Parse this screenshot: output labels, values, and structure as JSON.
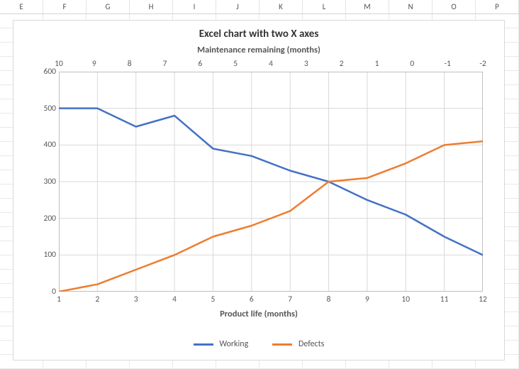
{
  "columns": [
    "E",
    "F",
    "G",
    "H",
    "I",
    "J",
    "K",
    "L",
    "M",
    "N",
    "O",
    "P"
  ],
  "chart_data": {
    "type": "line",
    "title": "Excel chart with two X axes",
    "xlabel": "Product life (months)",
    "secondary_xlabel": "Maintenance remaining (months)",
    "ylabel": "",
    "ylim": [
      0,
      600
    ],
    "y_ticks": [
      0,
      100,
      200,
      300,
      400,
      500,
      600
    ],
    "x": [
      1,
      2,
      3,
      4,
      5,
      6,
      7,
      8,
      9,
      10,
      11,
      12
    ],
    "secondary_x": [
      10,
      9,
      8,
      7,
      6,
      5,
      4,
      3,
      2,
      1,
      0,
      -1,
      -2
    ],
    "series": [
      {
        "name": "Working",
        "color": "#4472C4",
        "values": [
          500,
          500,
          450,
          480,
          390,
          370,
          330,
          300,
          250,
          210,
          150,
          100
        ]
      },
      {
        "name": "Defects",
        "color": "#ED7D31",
        "values": [
          0,
          20,
          60,
          100,
          150,
          180,
          220,
          300,
          310,
          350,
          400,
          410
        ]
      }
    ]
  }
}
